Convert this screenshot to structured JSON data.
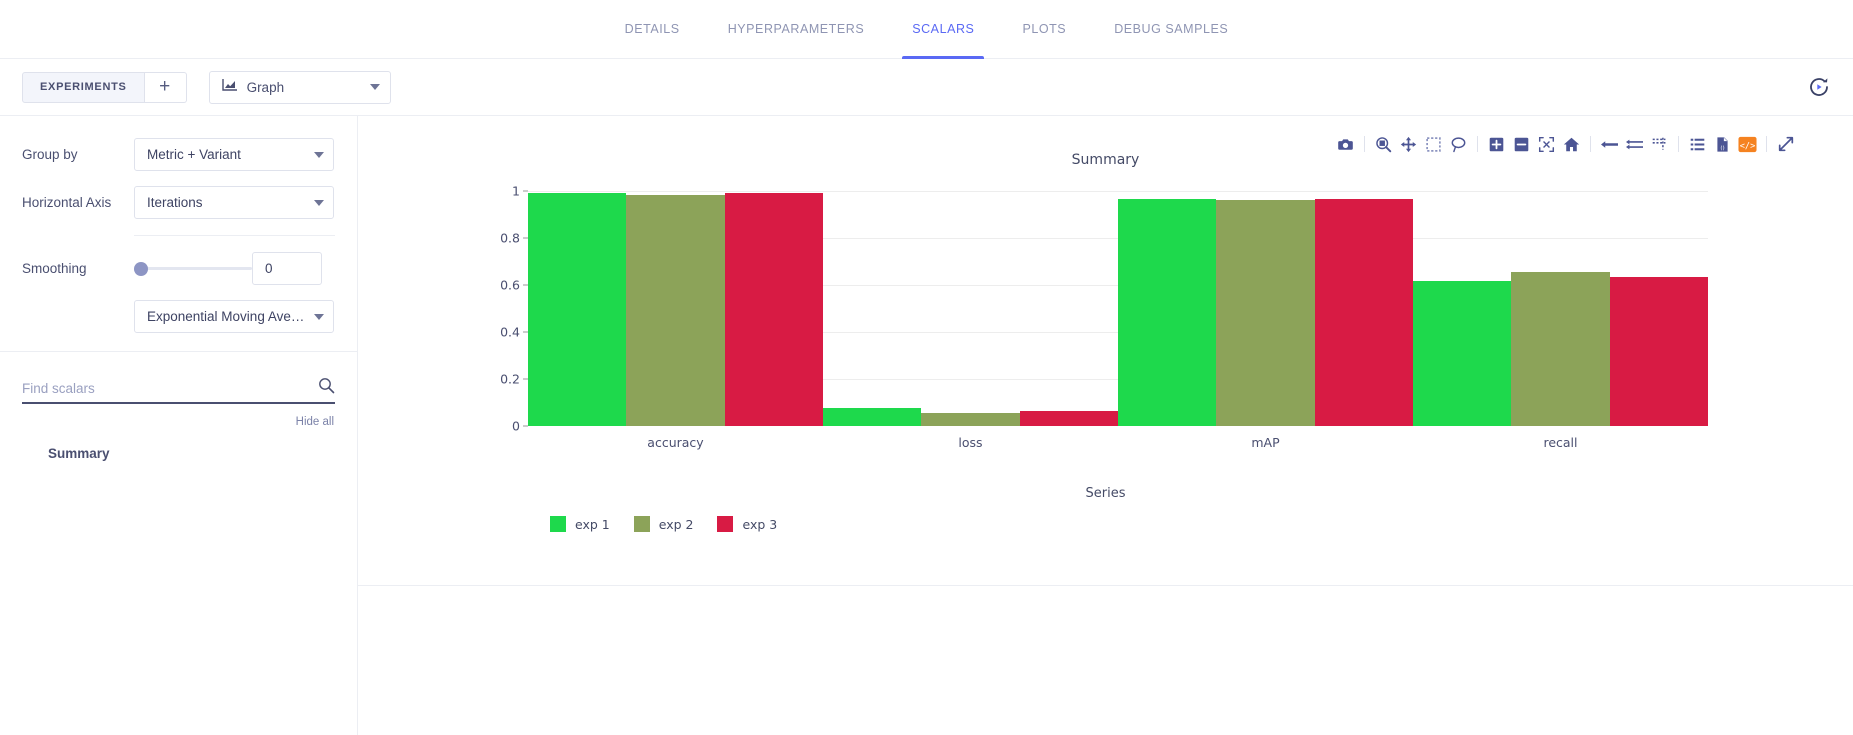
{
  "tabs": [
    {
      "label": "DETAILS",
      "active": false
    },
    {
      "label": "HYPERPARAMETERS",
      "active": false
    },
    {
      "label": "SCALARS",
      "active": true
    },
    {
      "label": "PLOTS",
      "active": false
    },
    {
      "label": "DEBUG SAMPLES",
      "active": false
    }
  ],
  "toolbar": {
    "experiments_label": "EXPERIMENTS",
    "add_label": "+",
    "graph_label": "Graph",
    "refresh_icon": "auto-refresh-icon"
  },
  "controls": {
    "group_by_label": "Group by",
    "group_by_value": "Metric + Variant",
    "horizontal_axis_label": "Horizontal Axis",
    "horizontal_axis_value": "Iterations",
    "smoothing_label": "Smoothing",
    "smoothing_value": "0",
    "smoothing_algorithm": "Exponential Moving Ave…"
  },
  "search": {
    "placeholder": "Find scalars",
    "value": "",
    "icon": "search-icon",
    "hide_all_label": "Hide all"
  },
  "scalars_list": [
    {
      "label": "Summary"
    }
  ],
  "modebar": {
    "buttons": [
      {
        "name": "camera-icon",
        "title": "Download plot as a png"
      },
      {
        "name": "zoom-icon",
        "title": "Zoom"
      },
      {
        "name": "pan-icon",
        "title": "Pan"
      },
      {
        "name": "box-select-icon",
        "title": "Box Select"
      },
      {
        "name": "lasso-select-icon",
        "title": "Lasso Select"
      },
      {
        "name": "zoom-in-icon",
        "title": "Zoom in"
      },
      {
        "name": "zoom-out-icon",
        "title": "Zoom out"
      },
      {
        "name": "autoscale-icon",
        "title": "Autoscale"
      },
      {
        "name": "reset-axes-icon",
        "title": "Reset axes"
      },
      {
        "name": "hover-closest-icon",
        "title": "Show closest data on hover"
      },
      {
        "name": "hover-compare-icon",
        "title": "Compare data on hover"
      },
      {
        "name": "spike-lines-icon",
        "title": "Toggle spike lines"
      },
      {
        "name": "log-list-icon",
        "title": "Show log"
      },
      {
        "name": "download-data-icon",
        "title": "Download data"
      },
      {
        "name": "embed-code-icon",
        "title": "Embed code"
      },
      {
        "name": "maximize-icon",
        "title": "Maximize"
      }
    ]
  },
  "colors": {
    "accent": "#5a69f4",
    "exp1": "#1ed94c",
    "exp2": "#8ca359",
    "exp3": "#d81b44",
    "axis": "#4a4f70",
    "grid": "#ededed",
    "border": "#eceef3"
  },
  "chart_data": {
    "type": "bar",
    "title": "Summary",
    "xlabel": "Series",
    "ylabel": "",
    "categories": [
      "accuracy",
      "loss",
      "mAP",
      "recall"
    ],
    "ylim": [
      0,
      1
    ],
    "yticks": [
      0,
      0.2,
      0.4,
      0.6,
      0.8,
      1
    ],
    "ytick_labels": [
      "0",
      "0.2",
      "0.4",
      "0.6",
      "0.8",
      "1"
    ],
    "grid": true,
    "legend_position": "bottom-left",
    "barmode": "group",
    "series": [
      {
        "name": "exp 1",
        "color": "#1ed94c",
        "values": [
          0.99,
          0.075,
          0.965,
          0.615
        ]
      },
      {
        "name": "exp 2",
        "color": "#8ca359",
        "values": [
          0.985,
          0.055,
          0.96,
          0.655
        ]
      },
      {
        "name": "exp 3",
        "color": "#d81b44",
        "values": [
          0.99,
          0.065,
          0.965,
          0.635
        ]
      }
    ]
  }
}
